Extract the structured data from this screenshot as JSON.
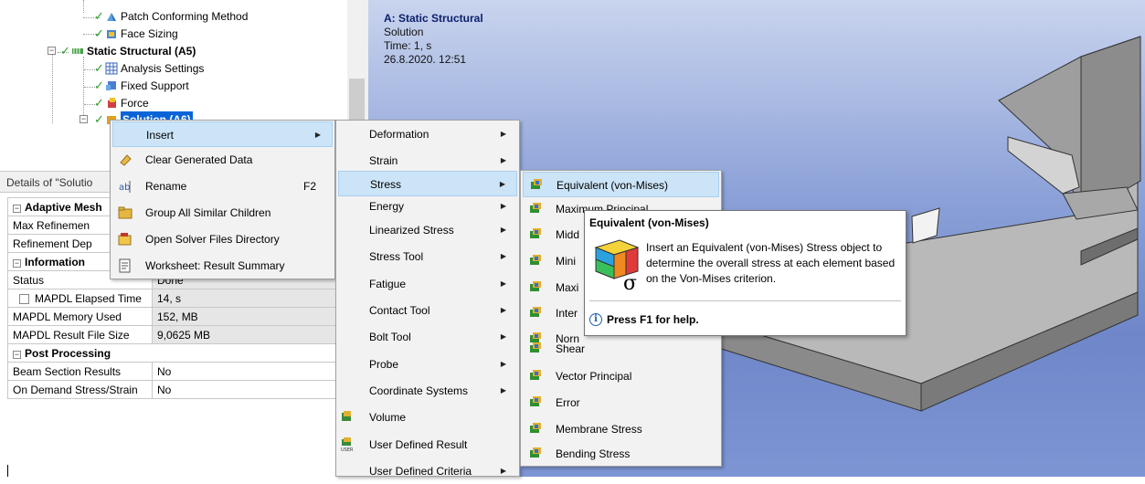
{
  "tree": {
    "items": [
      {
        "label": "Patch Conforming Method"
      },
      {
        "label": "Face Sizing"
      },
      {
        "label": "Static Structural (A5)"
      },
      {
        "label": "Analysis Settings"
      },
      {
        "label": "Fixed Support"
      },
      {
        "label": "Force"
      },
      {
        "label": "Solution (A6)"
      }
    ]
  },
  "details": {
    "title": "Details of \"Solutio",
    "rows": [
      {
        "type": "section",
        "key": "Adaptive Mesh"
      },
      {
        "key": "Max Refinemen",
        "value": ""
      },
      {
        "key": "Refinement Dep",
        "value": ""
      },
      {
        "type": "section",
        "key": "Information"
      },
      {
        "key": "Status",
        "value": "Done"
      },
      {
        "key": "MAPDL Elapsed Time",
        "value": "14, s",
        "checkbox": true
      },
      {
        "key": "MAPDL Memory Used",
        "value": "152, MB"
      },
      {
        "key": "MAPDL Result File Size",
        "value": "9,0625 MB"
      },
      {
        "type": "section",
        "key": "Post Processing"
      },
      {
        "key": "Beam Section Results",
        "value": "No"
      },
      {
        "key": "On Demand Stress/Strain",
        "value": "No"
      }
    ]
  },
  "viewport": {
    "title": "A: Static Structural",
    "line2": "Solution",
    "line3": "Time: 1, s",
    "line4": "26.8.2020. 12:51"
  },
  "context_menu": {
    "items": [
      {
        "label": "Insert",
        "icon": "none",
        "submenu": true
      },
      {
        "label": "Clear Generated Data",
        "icon": "eraser-icon"
      },
      {
        "label": "Rename",
        "icon": "rename-icon",
        "shortcut": "F2"
      },
      {
        "label": "Group All Similar Children",
        "icon": "folder-icon"
      },
      {
        "label": "Open Solver Files Directory",
        "icon": "open-folder-icon"
      },
      {
        "label": "Worksheet: Result Summary",
        "icon": "worksheet-icon"
      }
    ]
  },
  "insert_menu": {
    "items": [
      {
        "label": "Deformation"
      },
      {
        "label": "Strain"
      },
      {
        "label": "Stress"
      },
      {
        "label": "Energy"
      },
      {
        "label": "Linearized Stress"
      },
      {
        "label": "Stress Tool"
      },
      {
        "label": "Fatigue"
      },
      {
        "label": "Contact Tool"
      },
      {
        "label": "Bolt Tool"
      },
      {
        "label": "Probe"
      },
      {
        "label": "Coordinate Systems"
      },
      {
        "label": "Volume"
      },
      {
        "label": "User Defined Result"
      },
      {
        "label": "User Defined Criteria"
      }
    ]
  },
  "stress_menu": {
    "items": [
      {
        "label": "Equivalent (von-Mises)"
      },
      {
        "label": "Maximum Principal"
      },
      {
        "label": "Midd"
      },
      {
        "label": "Mini"
      },
      {
        "label": "Maxi"
      },
      {
        "label": "Inter"
      },
      {
        "label": "Norn"
      },
      {
        "label": "Shear"
      },
      {
        "label": "Vector Principal"
      },
      {
        "label": "Error"
      },
      {
        "label": "Membrane Stress"
      },
      {
        "label": "Bending Stress"
      }
    ]
  },
  "tooltip": {
    "title": "Equivalent (von-Mises)",
    "body": "Insert an Equivalent (von-Mises) Stress object to determine the overall stress at each element based on the Von-Mises criterion.",
    "help": "Press F1 for help.",
    "symbol": "σ"
  },
  "colors": {
    "highlight": "#cce4f7",
    "selection": "#0a64d6",
    "check": "#2e9a2e",
    "viewport_top": "#c9d4ee",
    "viewport_bottom": "#6f87c9"
  }
}
